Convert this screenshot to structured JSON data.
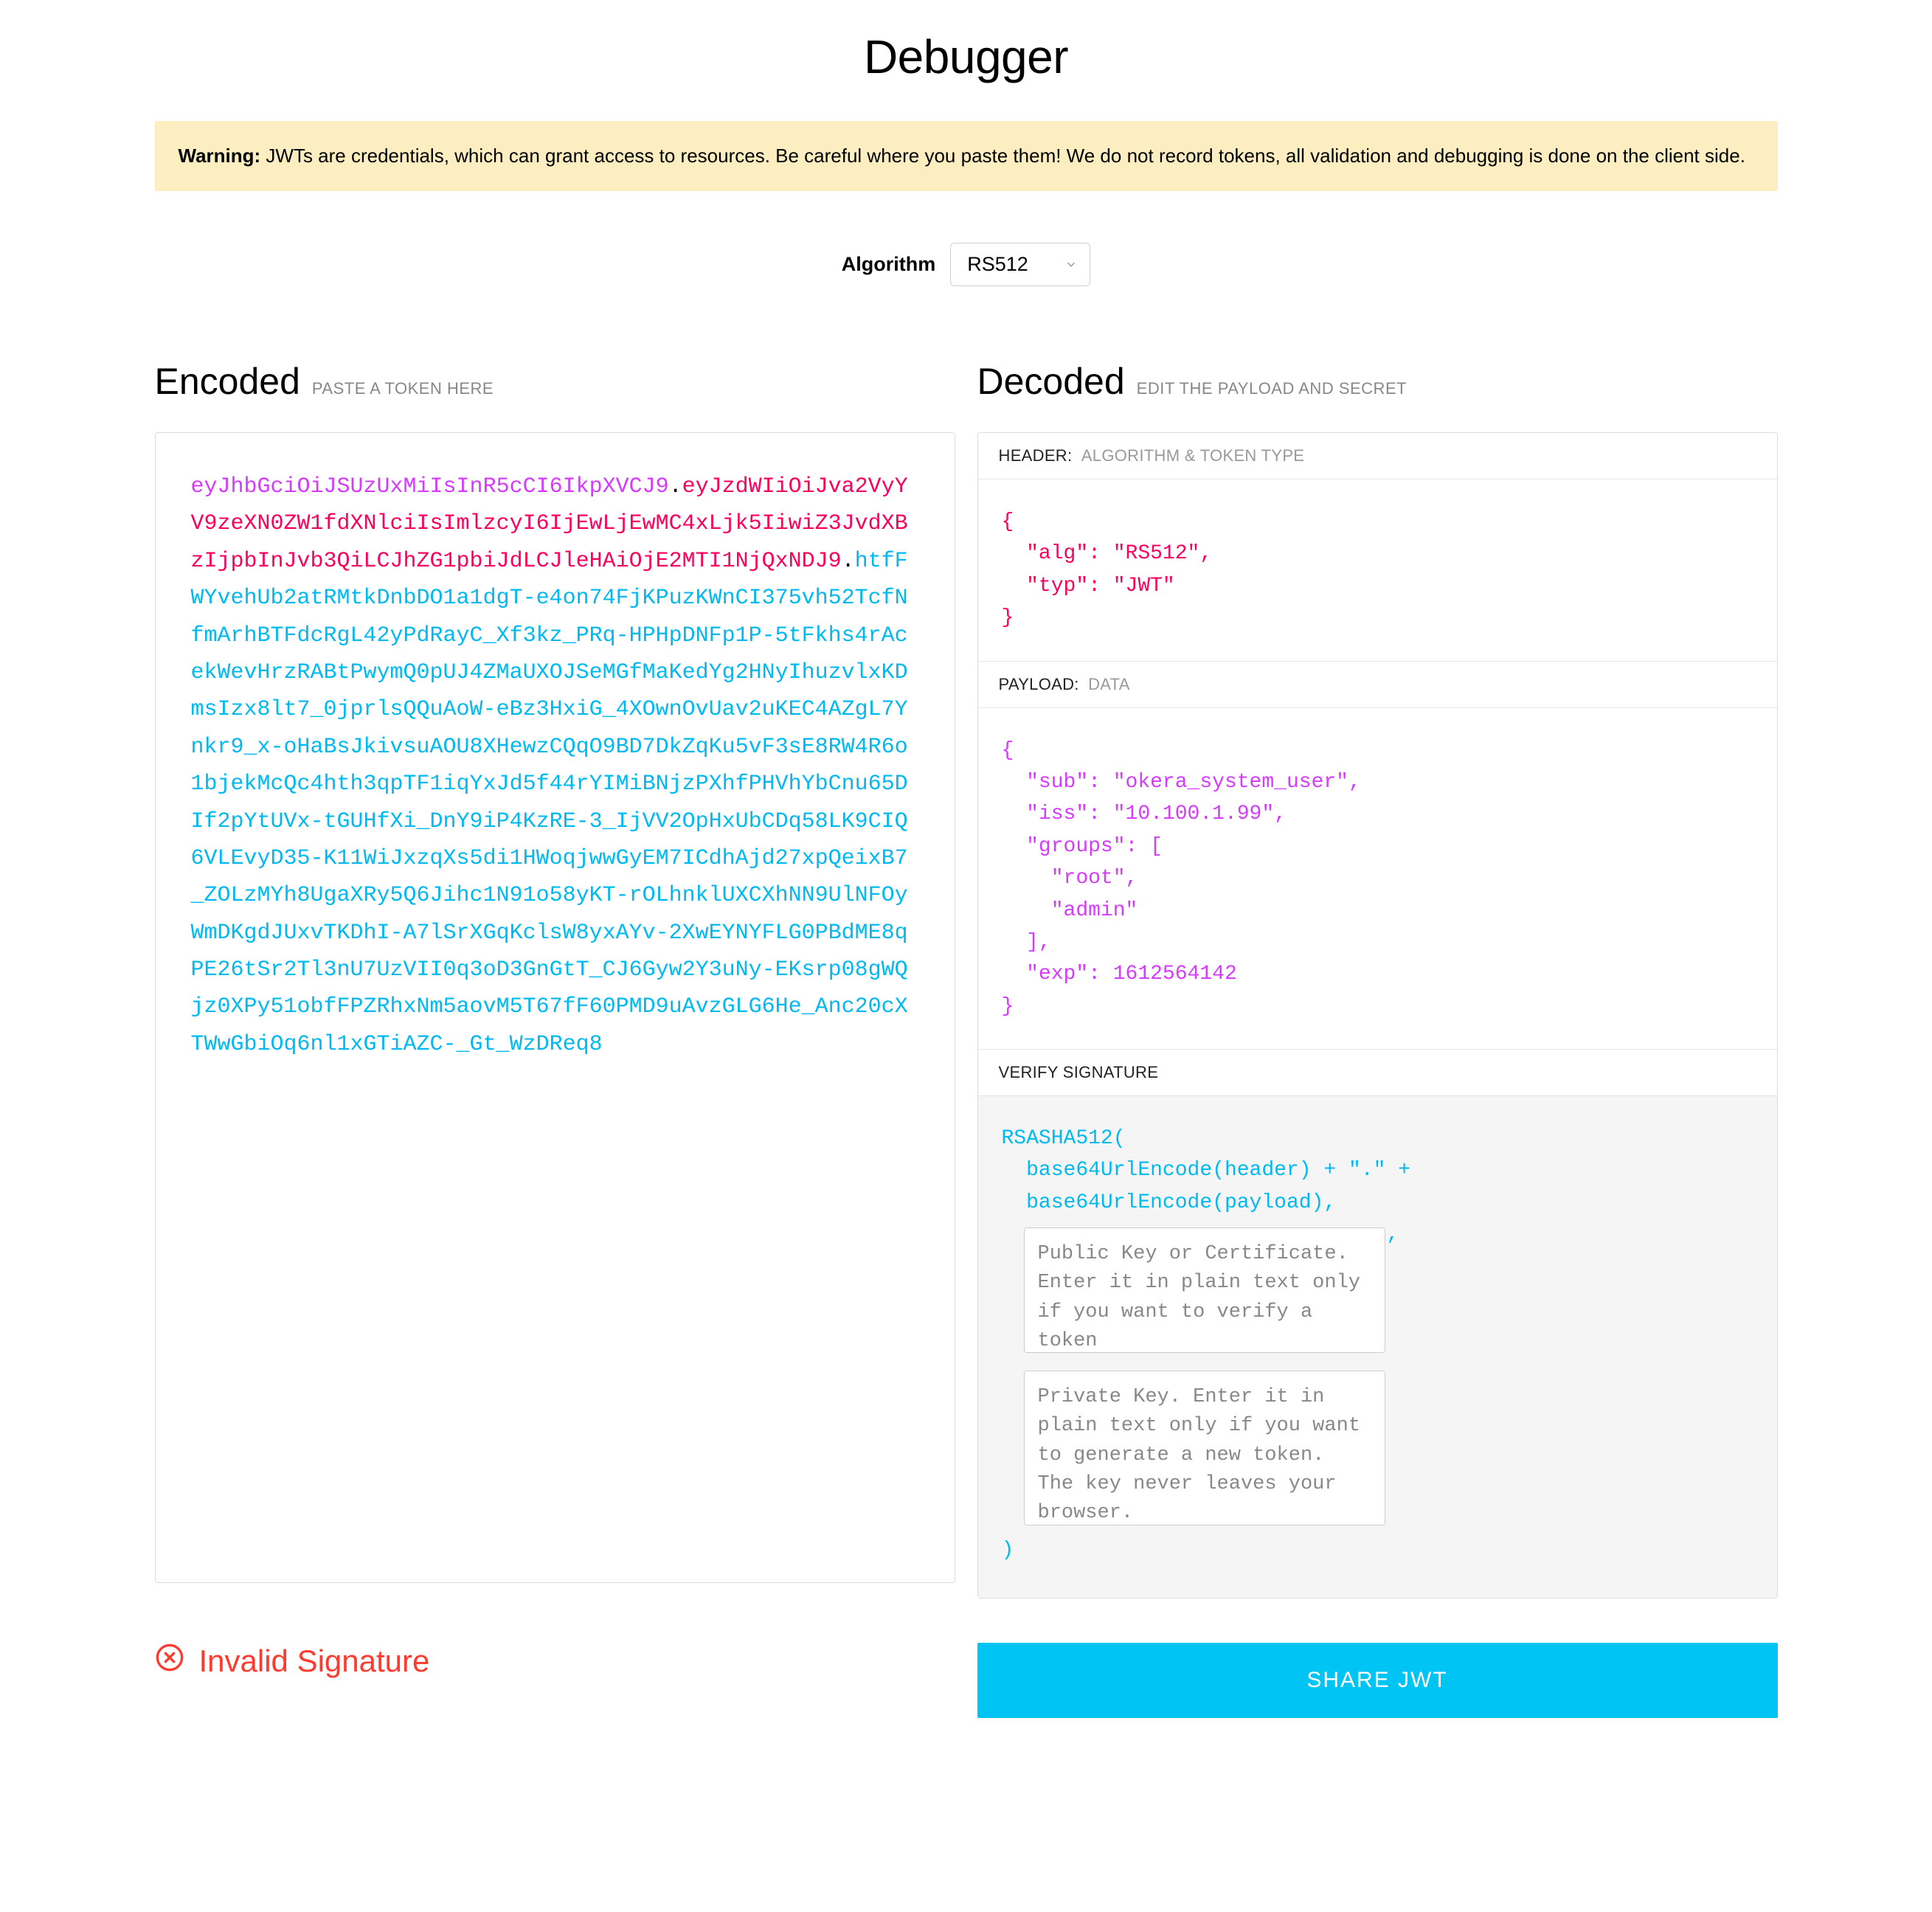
{
  "page_title": "Debugger",
  "warning": {
    "label": "Warning:",
    "text": " JWTs are credentials, which can grant access to resources. Be careful where you paste them! We do not record tokens, all validation and debugging is done on the client side."
  },
  "algorithm": {
    "label": "Algorithm",
    "selected": "RS512"
  },
  "encoded": {
    "title": "Encoded",
    "subtitle": "Paste a token here",
    "token_header": "eyJhbGciOiJSUzUxMiIsInR5cCI6IkpXVCJ9",
    "token_payload": "eyJzdWIiOiJva2VyYV9zeXN0ZW1fdXNlciIsImlzcyI6IjEwLjEwMC4xLjk5IiwiZ3JvdXBzIjpbInJvb3QiLCJhZG1pbiJdLCJleHAiOjE2MTI1NjQxNDJ9",
    "token_signature": "htfFWYvehUb2atRMtkDnbDO1a1dgT-e4on74FjKPuzKWnCI375vh52TcfNfmArhBTFdcRgL42yPdRayC_Xf3kz_PRq-HPHpDNFp1P-5tFkhs4rAcekWevHrzRABtPwymQ0pUJ4ZMaUXOJSeMGfMaKedYg2HNyIhuzvlxKDmsIzx8lt7_0jprlsQQuAoW-eBz3HxiG_4XOwnOvUav2uKEC4AZgL7Ynkr9_x-oHaBsJkivsuAOU8XHewzCQqO9BD7DkZqKu5vF3sE8RW4R6o1bjekMcQc4hth3qpTF1iqYxJd5f44rYIMiBNjzPXhfPHVhYbCnu65DIf2pYtUVx-tGUHfXi_DnY9iP4KzRE-3_IjVV2OpHxUbCDq58LK9CIQ6VLEvyD35-K11WiJxzqXs5di1HWoqjwwGyEM7ICdhAjd27xpQeixB7_ZOLzMYh8UgaXRy5Q6Jihc1N91o58yKT-rOLhnklUXCXhNN9UlNFOyWmDKgdJUxvTKDhI-A7lSrXGqKclsW8yxAYv-2XwEYNYFLG0PBdME8qPE26tSr2Tl3nU7UzVII0q3oD3GnGtT_CJ6Gyw2Y3uNy-EKsrp08gWQjz0XPy51obfFPZRhxNm5aovM5T67fF60PMD9uAvzGLG6He_Anc20cXTWwGbiOq6nl1xGTiAZC-_Gt_WzDReq8"
  },
  "decoded": {
    "title": "Decoded",
    "subtitle": "Edit the payload and secret",
    "header_section": {
      "label": "HEADER:",
      "sublabel": "ALGORITHM & TOKEN TYPE",
      "json": "{\n  \"alg\": \"RS512\",\n  \"typ\": \"JWT\"\n}"
    },
    "payload_section": {
      "label": "PAYLOAD:",
      "sublabel": "DATA",
      "json": "{\n  \"sub\": \"okera_system_user\",\n  \"iss\": \"10.100.1.99\",\n  \"groups\": [\n    \"root\",\n    \"admin\"\n  ],\n  \"exp\": 1612564142\n}"
    },
    "signature_section": {
      "label": "VERIFY SIGNATURE",
      "fn": "RSASHA512(",
      "line1": "  base64UrlEncode(header) + \".\" +",
      "line2": "  base64UrlEncode(payload),",
      "public_key_placeholder": "Public Key or Certificate. Enter it in plain text only if you want to verify a token",
      "private_key_placeholder": "Private Key. Enter it in plain text only if you want to generate a new token. The key never leaves your browser.",
      "close": ")"
    }
  },
  "status": {
    "text": "Invalid Signature"
  },
  "share_button": "SHARE JWT"
}
